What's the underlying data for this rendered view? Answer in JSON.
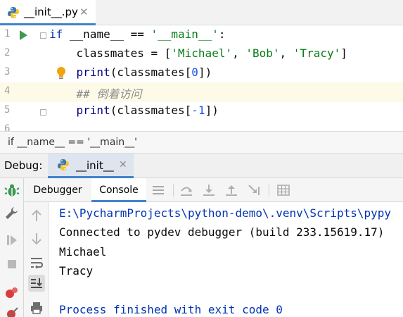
{
  "editor_tab": {
    "filename": "__init__.py",
    "close": "✕"
  },
  "editor": {
    "line_numbers": [
      "1",
      "2",
      "3",
      "4",
      "5",
      "6"
    ],
    "lines": {
      "l1": {
        "kw": "if",
        "a": " ",
        "dunder": "__name__",
        "b": " == ",
        "str": "'__main__'",
        "c": ":"
      },
      "l2": {
        "a": "    classmates = [",
        "s1": "'Michael'",
        "c1": ", ",
        "s2": "'Bob'",
        "c2": ", ",
        "s3": "'Tracy'",
        "b": "]"
      },
      "l3": {
        "a": "    ",
        "fn": "print",
        "b": "(classmates[",
        "num": "0",
        "c": "])"
      },
      "l4": {
        "a": "    ",
        "cmt": "## 倒着访问"
      },
      "l5": {
        "a": "    ",
        "fn": "print",
        "b": "(classmates[",
        "num": "-1",
        "c": "])"
      }
    }
  },
  "breadcrumb": "if __name__ == '__main__'",
  "debug": {
    "title": "Debug:",
    "session_tab": "__init__",
    "session_close": "✕"
  },
  "subtabs": {
    "debugger": "Debugger",
    "console": "Console"
  },
  "console": {
    "lines": [
      "E:\\PycharmProjects\\python-demo\\.venv\\Scripts\\pypy",
      "Connected to pydev debugger (build 233.15619.17)",
      "Michael",
      "Tracy",
      "",
      "Process finished with exit code 0"
    ]
  },
  "colors": {
    "accent": "#4083c9",
    "keyword": "#0033b3",
    "string": "#067d17",
    "number": "#1750eb",
    "comment": "#8c8c8c",
    "run_green": "#3d9a50"
  },
  "icons": {
    "run": "run-arrow-icon",
    "bulb": "lightbulb-icon",
    "python": "python-file-icon",
    "debug": "bug-icon",
    "settings": "wrench-icon",
    "resume": "resume-icon",
    "stop": "stop-icon",
    "breakpoints": "breakpoints-icon",
    "mute": "mute-breakpoints-icon",
    "up": "up-arrow-icon",
    "down": "down-arrow-icon",
    "soft_wrap": "soft-wrap-icon",
    "scroll_end": "scroll-to-end-icon",
    "print": "print-icon",
    "step_over": "step-over-icon",
    "step_into": "step-into-icon",
    "step_out": "step-out-icon",
    "run_to_cursor": "run-to-cursor-icon",
    "evaluate": "evaluate-icon",
    "layout": "layout-menu-icon"
  }
}
